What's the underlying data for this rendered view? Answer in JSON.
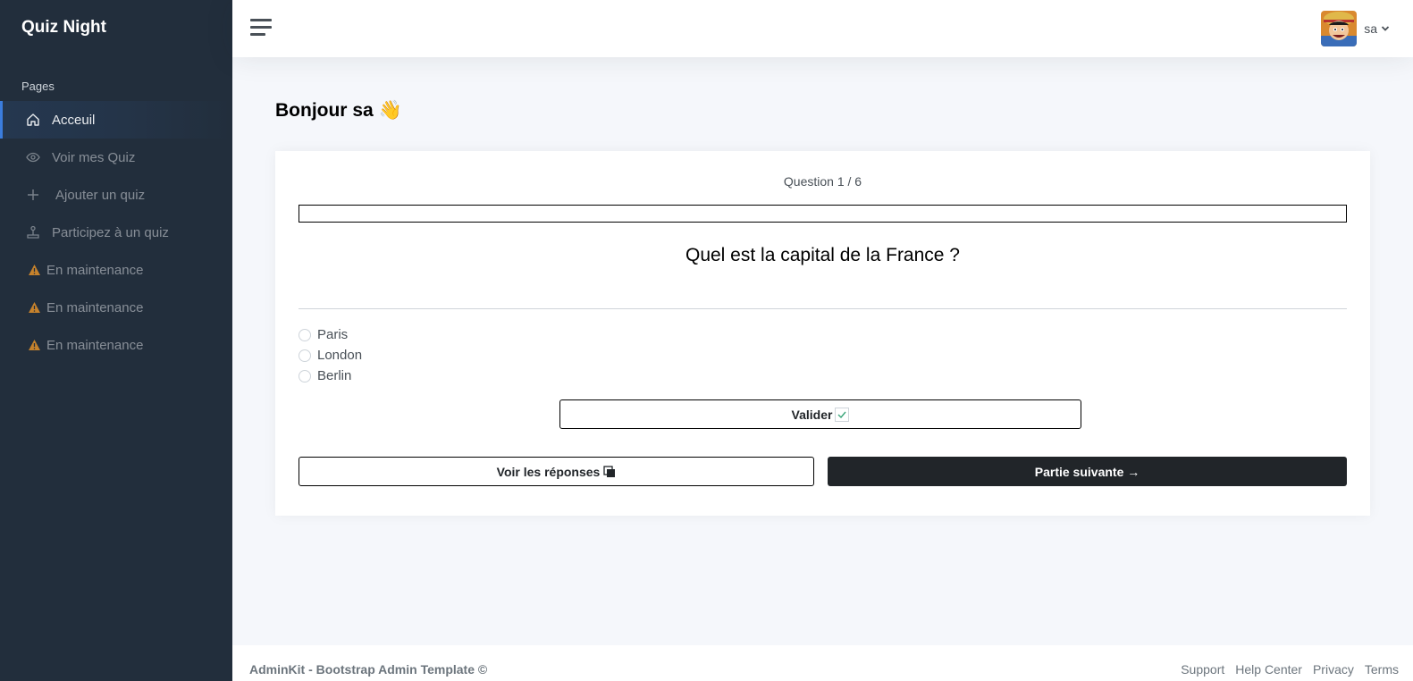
{
  "app": {
    "title": "Quiz Night"
  },
  "sidebar": {
    "header": "Pages",
    "items": [
      {
        "label": "Acceuil",
        "icon": "home-icon",
        "active": true
      },
      {
        "label": "Voir mes Quiz",
        "icon": "eye-icon"
      },
      {
        "label": "Ajouter un quiz",
        "icon": "plus-icon"
      },
      {
        "label": "Participez à un quiz",
        "icon": "joystick-icon"
      },
      {
        "label": "En maintenance",
        "icon": "warning-icon"
      },
      {
        "label": "En maintenance",
        "icon": "warning-icon"
      },
      {
        "label": "En maintenance",
        "icon": "warning-icon"
      }
    ]
  },
  "topbar": {
    "username": "sa"
  },
  "greeting": {
    "prefix": "Bonjour",
    "name": "sa",
    "emoji": "👋"
  },
  "quiz": {
    "counter": "Question 1 / 6",
    "progress": 0,
    "question": "Quel est la capital de la France ?",
    "options": [
      "Paris",
      "London",
      "Berlin"
    ],
    "validate_label": "Valider",
    "answers_label": "Voir les réponses",
    "next_label": "Partie suivante →"
  },
  "footer": {
    "left": "AdminKit - Bootstrap Admin Template ©",
    "links": [
      "Support",
      "Help Center",
      "Privacy",
      "Terms"
    ]
  },
  "colors": {
    "sidebar": "#222e3c",
    "accent": "#3b7ddd",
    "warning": "#c6822c",
    "dark_button": "#212529"
  }
}
